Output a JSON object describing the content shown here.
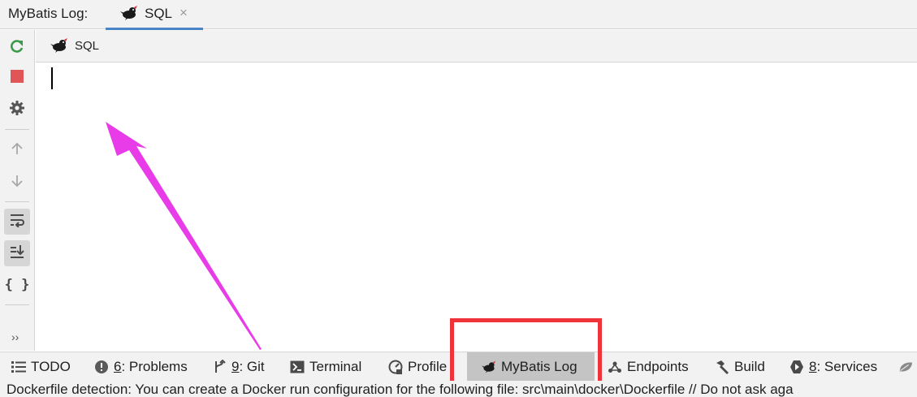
{
  "header": {
    "title": "MyBatis Log:",
    "tab_label": "SQL",
    "tab_close_glyph": "×",
    "tab_icon": "mybatis-bird-icon"
  },
  "left_toolbar": {
    "buttons": [
      {
        "name": "rerun-icon"
      },
      {
        "name": "stop-icon"
      },
      {
        "name": "settings-icon"
      },
      {
        "name": "up-arrow-icon"
      },
      {
        "name": "down-arrow-icon"
      },
      {
        "name": "soft-wrap-icon",
        "active": true
      },
      {
        "name": "scroll-to-end-icon",
        "active": true
      },
      {
        "name": "braces-icon"
      }
    ],
    "more_glyph": "››"
  },
  "console_tab": {
    "label": "SQL",
    "icon": "mybatis-bird-icon"
  },
  "bottom_bar": {
    "todo": "TODO",
    "problems_num": "6",
    "problems_label": ": Problems",
    "git_num": "9",
    "git_label": ": Git",
    "terminal": "Terminal",
    "profiler": "Profile",
    "mybatis_log": "MyBatis Log",
    "endpoints": "Endpoints",
    "build": "Build",
    "services_num": "8",
    "services_label": ": Services"
  },
  "status_bar": {
    "text": "Dockerfile detection: You can create a Docker run configuration for the following file: src\\main\\docker\\Dockerfile // Do not ask aga"
  },
  "colors": {
    "accent_tab": "#4a86c7",
    "annotation_arrow": "#e83ce8",
    "highlight_box": "#f0333a",
    "run_green": "#3c9b4a",
    "stop_red": "#e05555"
  }
}
